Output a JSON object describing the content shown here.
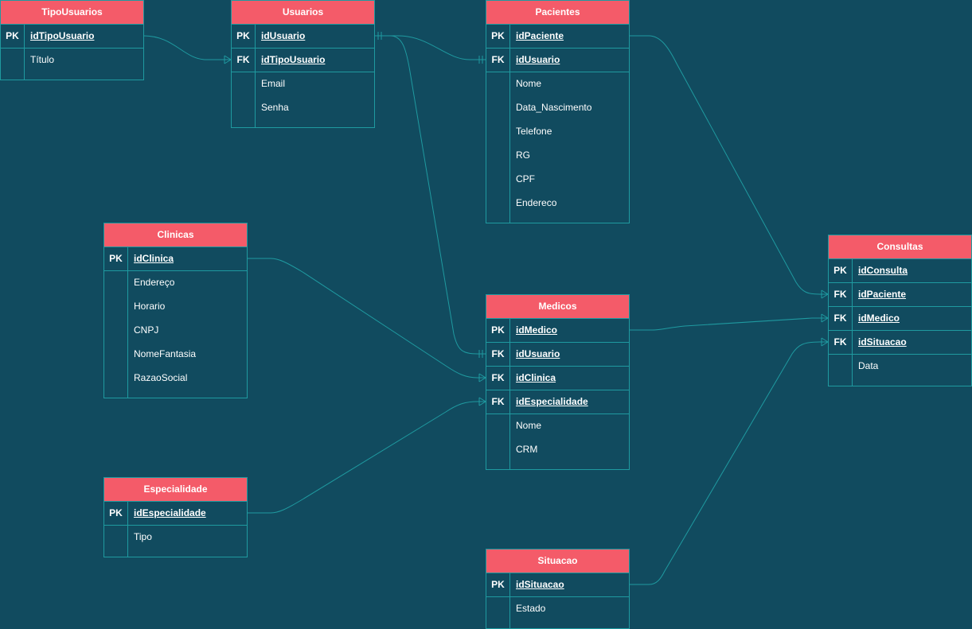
{
  "diagram": {
    "colors": {
      "background": "#114b5f",
      "header": "#f45b69",
      "border": "#1f9aa0",
      "text": "#ffffff"
    },
    "entities": [
      {
        "title": "TipoUsuarios",
        "rows": [
          {
            "key": "PK",
            "name": "idTipoUsuario"
          },
          {
            "key": "",
            "name": "Título"
          }
        ]
      },
      {
        "title": "Usuarios",
        "rows": [
          {
            "key": "PK",
            "name": "idUsuario"
          },
          {
            "key": "FK",
            "name": "idTipoUsuario"
          },
          {
            "key": "",
            "name": "Email"
          },
          {
            "key": "",
            "name": "Senha"
          }
        ]
      },
      {
        "title": "Pacientes",
        "rows": [
          {
            "key": "PK",
            "name": "idPaciente"
          },
          {
            "key": "FK",
            "name": "idUsuario"
          },
          {
            "key": "",
            "name": "Nome"
          },
          {
            "key": "",
            "name": "Data_Nascimento"
          },
          {
            "key": "",
            "name": "Telefone"
          },
          {
            "key": "",
            "name": "RG"
          },
          {
            "key": "",
            "name": "CPF"
          },
          {
            "key": "",
            "name": "Endereco"
          }
        ]
      },
      {
        "title": "Clinicas",
        "rows": [
          {
            "key": "PK",
            "name": "idClinica"
          },
          {
            "key": "",
            "name": "Endereço"
          },
          {
            "key": "",
            "name": "Horario"
          },
          {
            "key": "",
            "name": "CNPJ"
          },
          {
            "key": "",
            "name": "NomeFantasia"
          },
          {
            "key": "",
            "name": "RazaoSocial"
          }
        ]
      },
      {
        "title": "Medicos",
        "rows": [
          {
            "key": "PK",
            "name": "idMedico"
          },
          {
            "key": "FK",
            "name": "idUsuario"
          },
          {
            "key": "FK",
            "name": "idClinica"
          },
          {
            "key": "FK",
            "name": "idEspecialidade"
          },
          {
            "key": "",
            "name": "Nome"
          },
          {
            "key": "",
            "name": "CRM"
          }
        ]
      },
      {
        "title": "Consultas",
        "rows": [
          {
            "key": "PK",
            "name": "idConsulta"
          },
          {
            "key": "FK",
            "name": "idPaciente"
          },
          {
            "key": "FK",
            "name": "idMedico"
          },
          {
            "key": "FK",
            "name": "idSituacao"
          },
          {
            "key": "",
            "name": "Data"
          }
        ]
      },
      {
        "title": "Especialidade",
        "rows": [
          {
            "key": "PK",
            "name": "idEspecialidade"
          },
          {
            "key": "",
            "name": "Tipo"
          }
        ]
      },
      {
        "title": "Situacao",
        "rows": [
          {
            "key": "PK",
            "name": "idSituacao"
          },
          {
            "key": "",
            "name": "Estado"
          }
        ]
      }
    ]
  }
}
